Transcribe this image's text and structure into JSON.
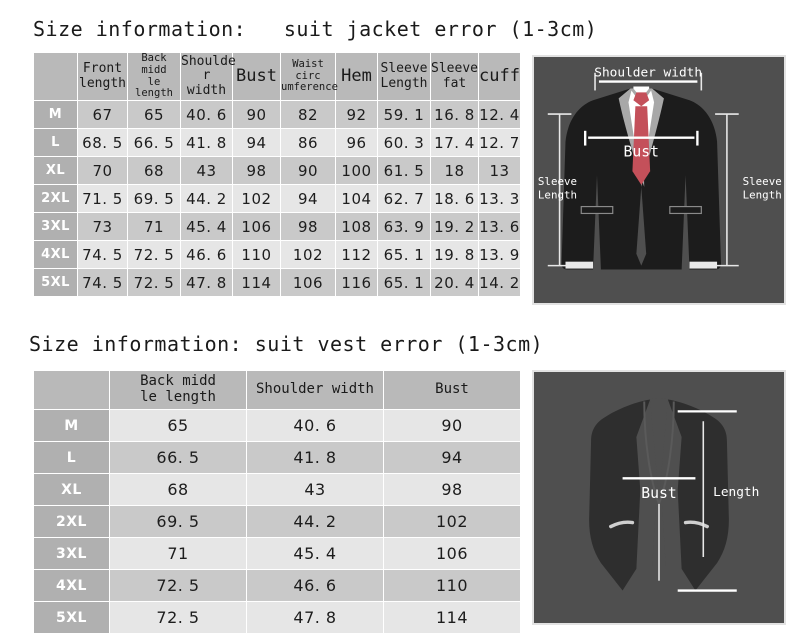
{
  "jacket": {
    "title": "Size information:   suit jacket error (1-3cm)",
    "table": {
      "corner": "",
      "columns": [
        {
          "label": "Front\nlength",
          "size": "md"
        },
        {
          "label": "Back midd\nle length",
          "size": "sm"
        },
        {
          "label": "Shoulde\nr width",
          "size": "md"
        },
        {
          "label": "Bust",
          "size": "lg"
        },
        {
          "label": "Waist circ\numference",
          "size": "sm"
        },
        {
          "label": "Hem",
          "size": "lg"
        },
        {
          "label": "Sleeve\nLength",
          "size": "md"
        },
        {
          "label": "Sleeve\nfat",
          "size": "md"
        },
        {
          "label": "cuff",
          "size": "lg"
        }
      ],
      "rows": [
        {
          "size": "M",
          "shade": "dark",
          "values": [
            "67",
            "65",
            "40. 6",
            "90",
            "82",
            "92",
            "59. 1",
            "16. 8",
            "12. 4"
          ]
        },
        {
          "size": "L",
          "shade": "light",
          "values": [
            "68. 5",
            "66. 5",
            "41. 8",
            "94",
            "86",
            "96",
            "60. 3",
            "17. 4",
            "12. 7"
          ]
        },
        {
          "size": "XL",
          "shade": "dark",
          "values": [
            "70",
            "68",
            "43",
            "98",
            "90",
            "100",
            "61. 5",
            "18",
            "13"
          ]
        },
        {
          "size": "2XL",
          "shade": "light",
          "values": [
            "71. 5",
            "69. 5",
            "44. 2",
            "102",
            "94",
            "104",
            "62. 7",
            "18. 6",
            "13. 3"
          ]
        },
        {
          "size": "3XL",
          "shade": "dark",
          "values": [
            "73",
            "71",
            "45. 4",
            "106",
            "98",
            "108",
            "63. 9",
            "19. 2",
            "13. 6"
          ]
        },
        {
          "size": "4XL",
          "shade": "light",
          "values": [
            "74. 5",
            "72. 5",
            "46. 6",
            "110",
            "102",
            "112",
            "65. 1",
            "19. 8",
            "13. 9"
          ]
        },
        {
          "size": "5XL",
          "shade": "dark",
          "values": [
            "74. 5",
            "72. 5",
            "47. 8",
            "114",
            "106",
            "116",
            "65. 1",
            "20. 4",
            "14. 2"
          ]
        }
      ]
    },
    "diagram": {
      "shoulder_width_label": "Shoulder width",
      "sleeve_length_left_label": "Sleeve\nLength",
      "sleeve_length_right_label": "Sleeve\nLength",
      "bust_label": "Bust",
      "colors": {
        "background": "#4f4f4f",
        "jacket": "#1c1c1c",
        "lapel": "#a8a8a8",
        "shirt": "#ffffff",
        "tie": "#c4505a",
        "cuff": "#e8e8e8"
      }
    }
  },
  "vest": {
    "title": "Size information: suit vest error (1-3cm)",
    "table": {
      "corner": "",
      "columns": [
        {
          "label": "Back midd\nle length"
        },
        {
          "label": "Shoulder width"
        },
        {
          "label": "Bust"
        }
      ],
      "rows": [
        {
          "size": "M",
          "shade": "light",
          "values": [
            "65",
            "40. 6",
            "90"
          ]
        },
        {
          "size": "L",
          "shade": "dark",
          "values": [
            "66. 5",
            "41. 8",
            "94"
          ]
        },
        {
          "size": "XL",
          "shade": "light",
          "values": [
            "68",
            "43",
            "98"
          ]
        },
        {
          "size": "2XL",
          "shade": "dark",
          "values": [
            "69. 5",
            "44. 2",
            "102"
          ]
        },
        {
          "size": "3XL",
          "shade": "light",
          "values": [
            "71",
            "45. 4",
            "106"
          ]
        },
        {
          "size": "4XL",
          "shade": "dark",
          "values": [
            "72. 5",
            "46. 6",
            "110"
          ]
        },
        {
          "size": "5XL",
          "shade": "light",
          "values": [
            "72. 5",
            "47. 8",
            "114"
          ]
        }
      ]
    },
    "diagram": {
      "bust_label": "Bust",
      "length_label": "Length",
      "colors": {
        "background": "#4f4f4f",
        "vest": "#2e2e2e",
        "seam": "#5a5a5a",
        "pocket": "#cfcfcf"
      }
    }
  }
}
